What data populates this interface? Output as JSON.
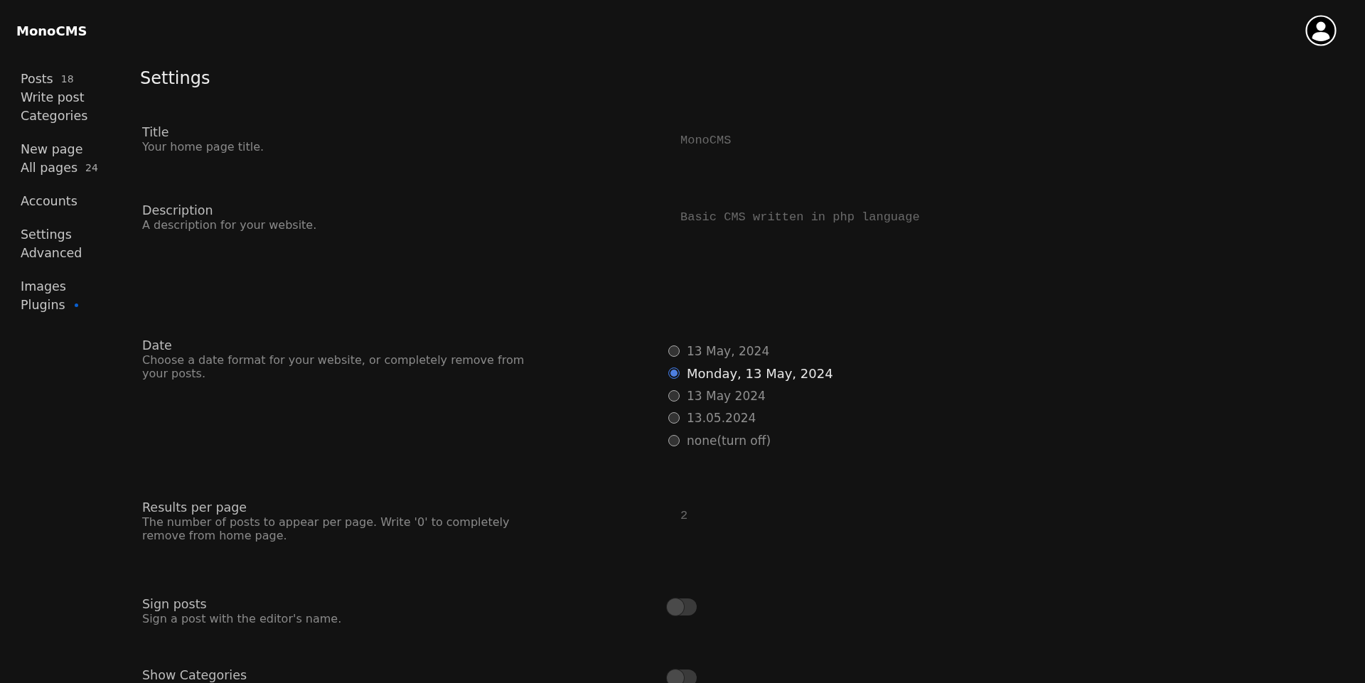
{
  "brand": "MonoCMS",
  "sidebar": {
    "groups": [
      {
        "items": [
          {
            "label": "Posts",
            "count": "18"
          },
          {
            "label": "Write post"
          },
          {
            "label": "Categories"
          }
        ]
      },
      {
        "items": [
          {
            "label": "New page"
          },
          {
            "label": "All pages",
            "count": "24"
          }
        ]
      },
      {
        "items": [
          {
            "label": "Accounts"
          }
        ]
      },
      {
        "items": [
          {
            "label": "Settings"
          },
          {
            "label": "Advanced"
          }
        ]
      },
      {
        "items": [
          {
            "label": "Images"
          },
          {
            "label": "Plugins",
            "color": "#0a5fd0"
          }
        ]
      }
    ]
  },
  "page_title": "Settings",
  "settings": [
    {
      "kind": "text",
      "label": "Title",
      "hint": "Your home page title.",
      "value": "MonoCMS"
    },
    {
      "kind": "textarea",
      "label": "Description",
      "hint": "A description for your website.",
      "value": "Basic CMS written in php language"
    },
    {
      "kind": "radio",
      "label": "Date",
      "hint": "Choose a date format for your website, or completely remove from your posts.",
      "options": [
        {
          "label": "13 May, 2024",
          "selected": false
        },
        {
          "label": "Monday, 13 May, 2024",
          "selected": true
        },
        {
          "label": "13 May 2024",
          "selected": false
        },
        {
          "label": "13.05.2024",
          "selected": false
        },
        {
          "label": "none(turn off)",
          "selected": false
        }
      ]
    },
    {
      "kind": "number",
      "label": "Results per page",
      "hint": "The number of posts to appear per page. Write '0' to completely remove from home page.",
      "value": "2"
    },
    {
      "kind": "toggle",
      "label": "Sign posts",
      "hint": "Sign a post with the editor's name.",
      "on": false
    },
    {
      "kind": "toggle",
      "label": "Show Categories",
      "on": false
    }
  ]
}
